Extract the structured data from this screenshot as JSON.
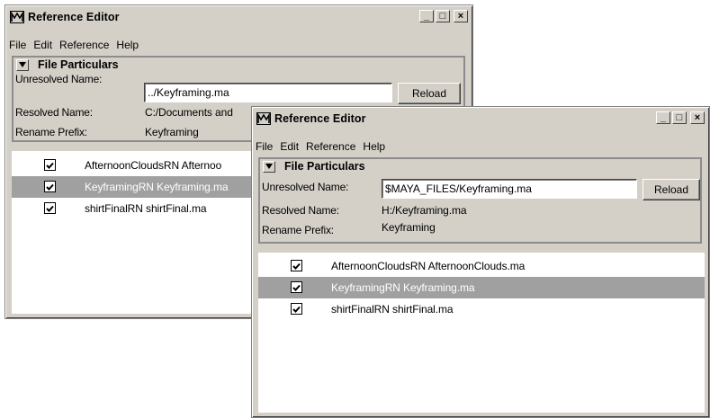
{
  "windows": [
    {
      "id": "back",
      "title": "Reference Editor",
      "controls": {
        "minimize": "_",
        "maximize": "□",
        "close": "×"
      },
      "menu": [
        "File",
        "Edit",
        "Reference",
        "Help"
      ],
      "group_title": "File Particulars",
      "unresolved_label": "Unresolved Name:",
      "unresolved_value": "../Keyframing.ma",
      "reload_label": "Reload",
      "resolved_label": "Resolved Name:",
      "resolved_value": "C:/Documents and",
      "prefix_label": "Rename Prefix:",
      "prefix_value": "Keyframing",
      "references": [
        {
          "name": "AfternoonCloudsRN Afternoo",
          "checked": true,
          "selected": false
        },
        {
          "name": "KeyframingRN Keyframing.ma",
          "checked": true,
          "selected": true
        },
        {
          "name": "shirtFinalRN shirtFinal.ma",
          "checked": true,
          "selected": false
        }
      ]
    },
    {
      "id": "front",
      "title": "Reference Editor",
      "controls": {
        "minimize": "_",
        "maximize": "□",
        "close": "×"
      },
      "menu": [
        "File",
        "Edit",
        "Reference",
        "Help"
      ],
      "group_title": "File Particulars",
      "unresolved_label": "Unresolved Name:",
      "unresolved_value": "$MAYA_FILES/Keyframing.ma",
      "reload_label": "Reload",
      "resolved_label": "Resolved Name:",
      "resolved_value": "H:/Keyframing.ma",
      "prefix_label": "Rename Prefix:",
      "prefix_value": "Keyframing",
      "references": [
        {
          "name": "AfternoonCloudsRN AfternoonClouds.ma",
          "checked": true,
          "selected": false
        },
        {
          "name": "KeyframingRN Keyframing.ma",
          "checked": true,
          "selected": true
        },
        {
          "name": "shirtFinalRN shirtFinal.ma",
          "checked": true,
          "selected": false
        }
      ]
    }
  ],
  "icons": {
    "app": "maya-logo-icon",
    "collapse": "triangle-down-icon",
    "check": "checkmark-icon"
  },
  "colors": {
    "window_bg": "#d4d0c8",
    "selection_bg": "#a0a0a0",
    "selection_text": "#ffffff"
  }
}
